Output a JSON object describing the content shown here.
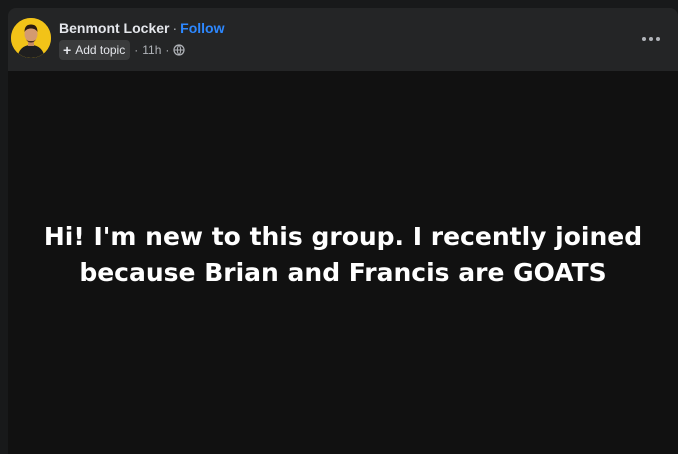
{
  "post": {
    "author": "Benmont Locker",
    "separator": "·",
    "follow_label": "Follow",
    "add_topic_label": "Add topic",
    "plus_symbol": "+",
    "time": "11h",
    "visibility_icon": "globe-icon",
    "more_icon": "more-options-icon",
    "text": "Hi! I'm new to this group. I recently joined because Brian and Francis are GOATS"
  },
  "colors": {
    "card_background": "#242526",
    "content_background": "#111111",
    "link_blue": "#2d88ff",
    "avatar_background": "#f2c318"
  }
}
